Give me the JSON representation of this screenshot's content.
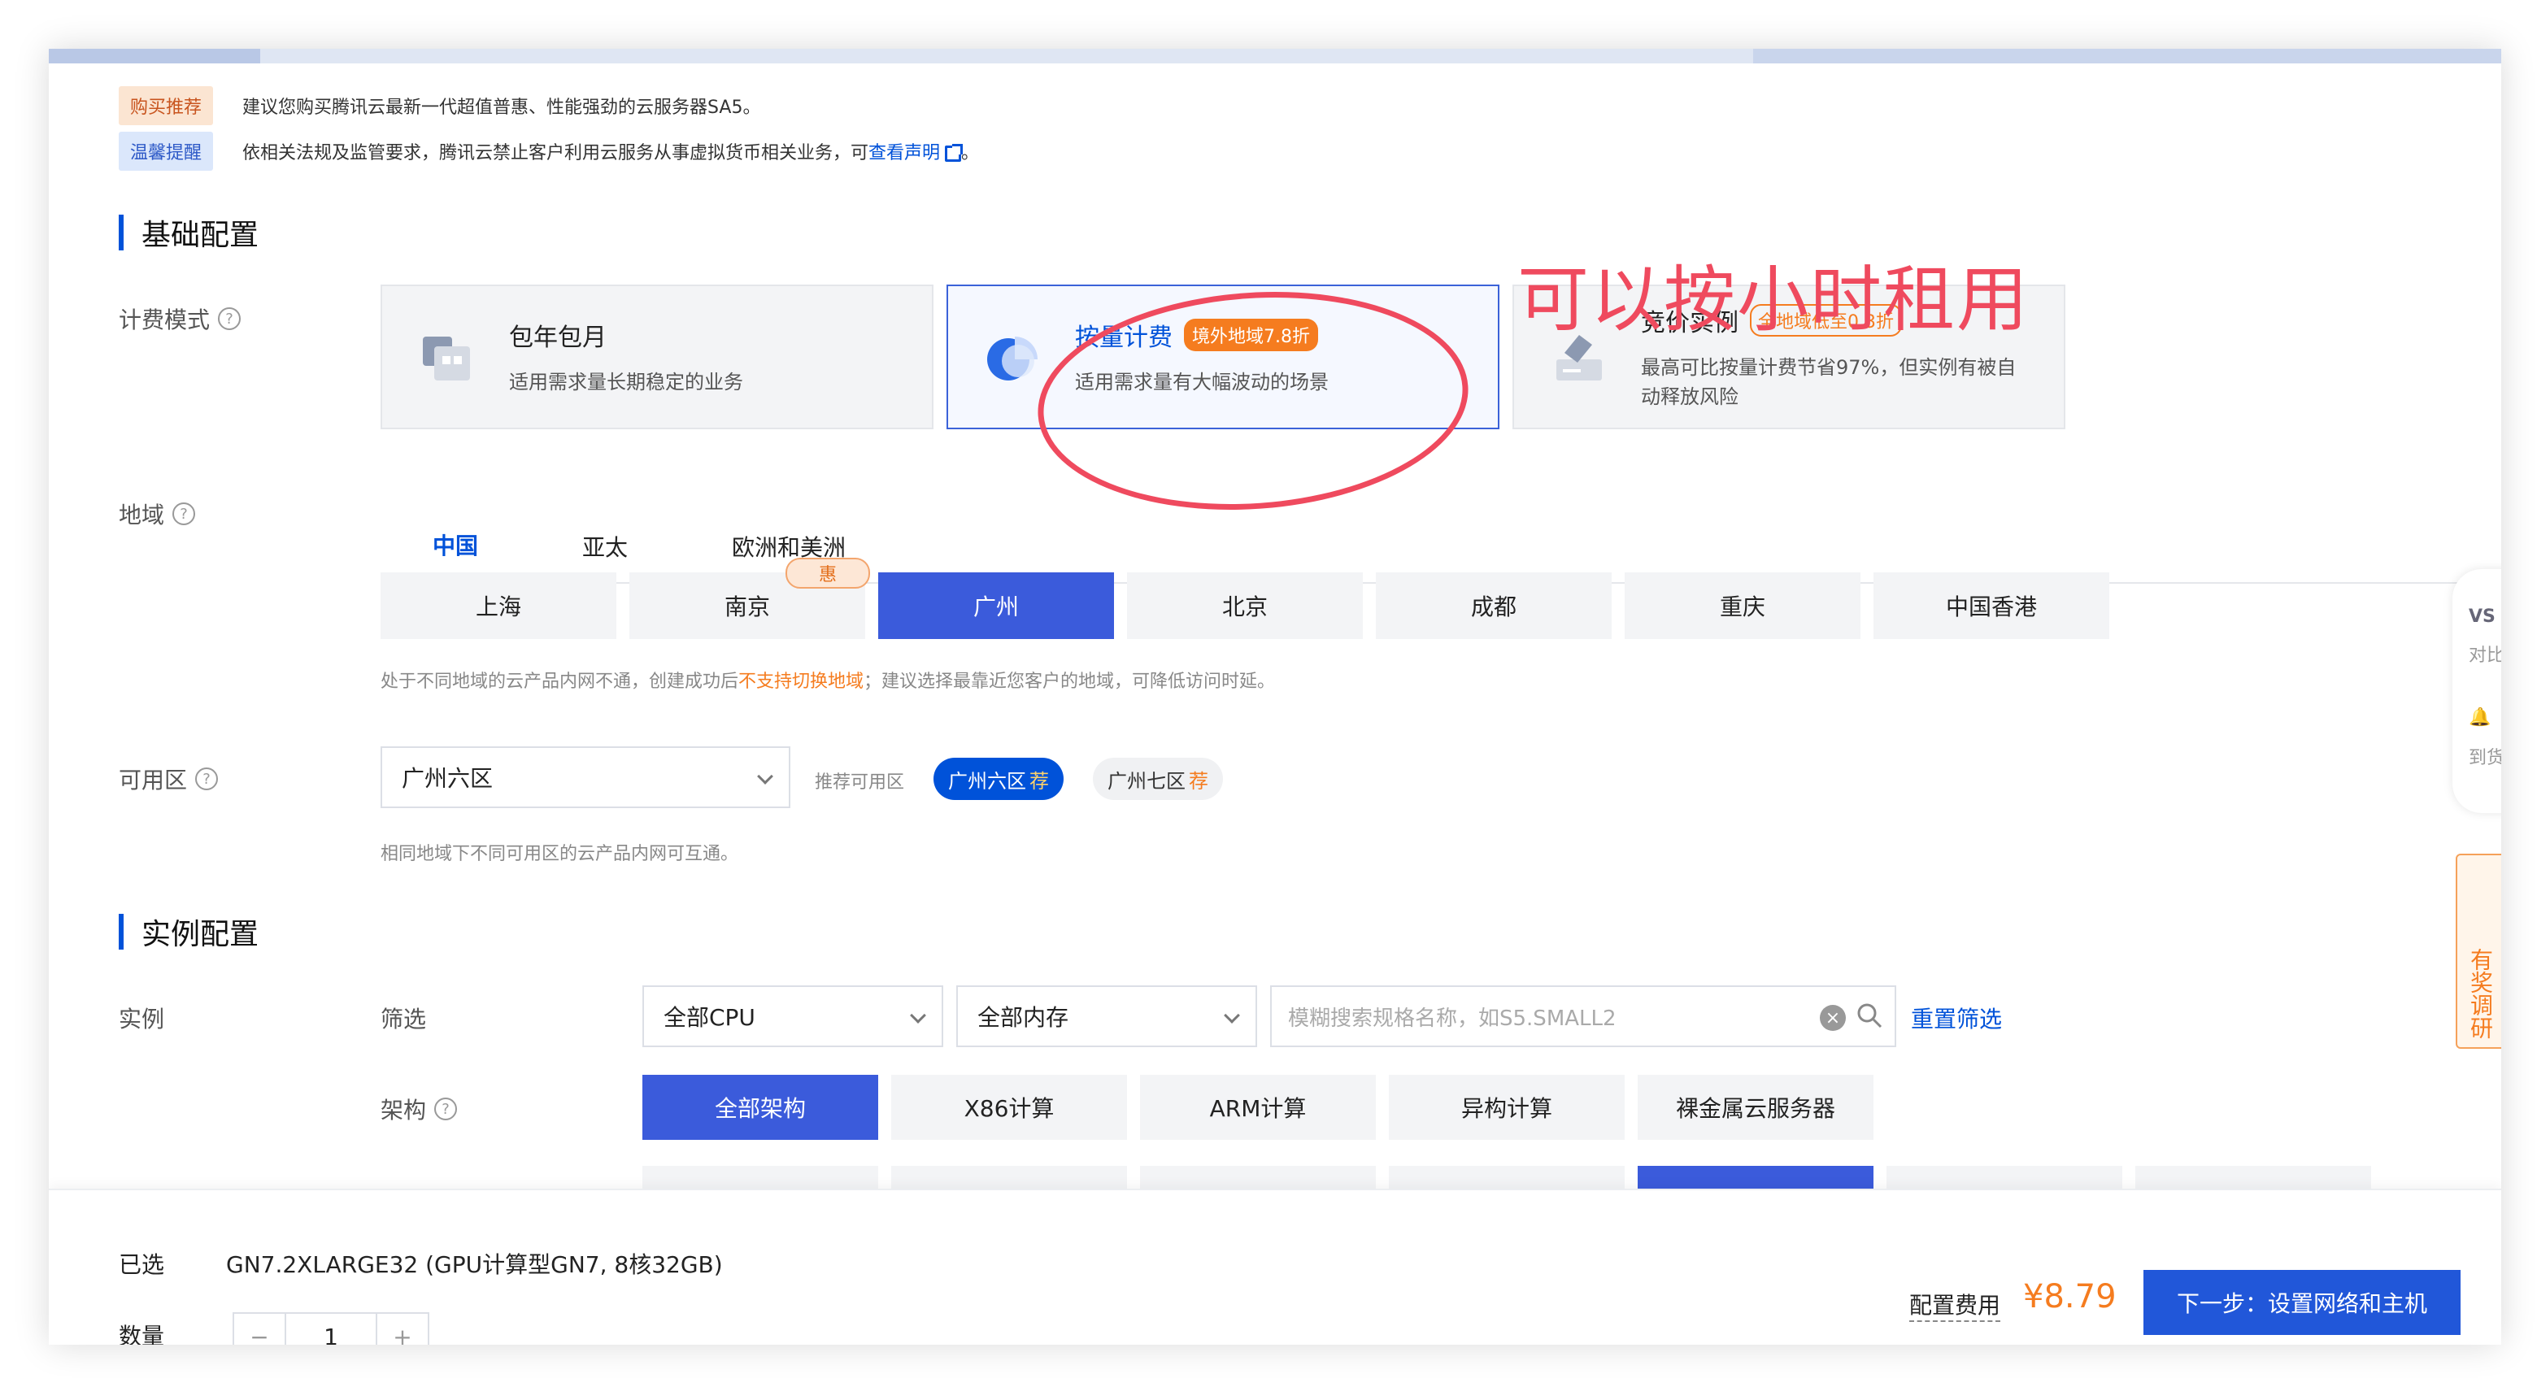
{
  "notices": [
    {
      "tag": "购买推荐",
      "text": "建议您购买腾讯云最新一代超值普惠、性能强劲的云服务器SA5。"
    },
    {
      "tag": "温馨提醒",
      "text_before": "依相关法规及监管要求，腾讯云禁止客户利用云服务从事虚拟货币相关业务，可",
      "link": "查看声明",
      "text_after": "。"
    }
  ],
  "sections": {
    "basic": "基础配置",
    "instance": "实例配置"
  },
  "billing": {
    "label": "计费模式",
    "options": [
      {
        "title": "包年包月",
        "desc": "适用需求量长期稳定的业务"
      },
      {
        "title": "按量计费",
        "badge": "境外地域7.8折",
        "desc": "适用需求量有大幅波动的场景"
      },
      {
        "title": "竞价实例",
        "badge": "全地域低至0.3折",
        "desc": "最高可比按量计费节省97%，但实例有被自动释放风险"
      }
    ]
  },
  "region": {
    "label": "地域",
    "tabs": [
      "中国",
      "亚太",
      "欧洲和美洲"
    ],
    "cities": [
      "上海",
      "南京",
      "广州",
      "北京",
      "成都",
      "重庆",
      "中国香港"
    ],
    "hui": "惠",
    "note_before": "处于不同地域的云产品内网不通，创建成功后",
    "note_warn": "不支持切换地域",
    "note_after": "；建议选择最靠近您客户的地域，可降低访问时延。"
  },
  "zone": {
    "label": "可用区",
    "selected": "广州六区",
    "rec_label": "推荐可用区",
    "rec": [
      {
        "name": "广州六区",
        "mark": "荐"
      },
      {
        "name": "广州七区",
        "mark": "荐"
      }
    ],
    "note": "相同地域下不同可用区的云产品内网可互通。"
  },
  "instance": {
    "label": "实例",
    "filter_label": "筛选",
    "cpu": "全部CPU",
    "mem": "全部内存",
    "search_placeholder": "模糊搜索规格名称，如S5.SMALL2",
    "reset": "重置筛选",
    "arch_label": "架构",
    "archs": [
      "全部架构",
      "X86计算",
      "ARM计算",
      "异构计算",
      "裸金属云服务器"
    ]
  },
  "footer": {
    "selected_label": "已选",
    "selected_value": "GN7.2XLARGE32 (GPU计算型GN7, 8核32GB)",
    "qty_label": "数量",
    "qty": "1",
    "fee_label": "配置费用",
    "fee": "¥8.79",
    "next": "下一步：设置网络和主机"
  },
  "side": {
    "compare": "对比",
    "notify": "到货",
    "survey": "有奖调研"
  },
  "annotation": "可以按小时租用",
  "colors": {
    "primary": "#0052d9",
    "accent": "#f57c1f",
    "annotation": "#ef4a5e"
  }
}
